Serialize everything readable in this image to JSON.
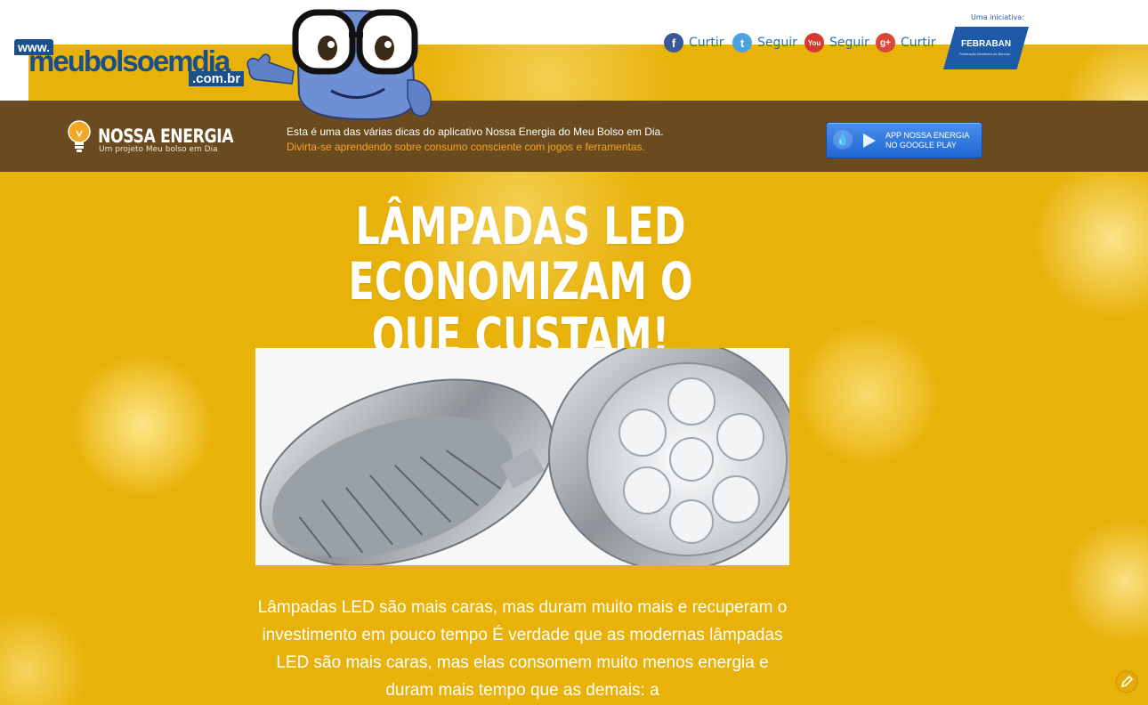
{
  "header": {
    "logo": {
      "www": "www.",
      "main": "meubolsoemdia",
      "domain": ".com.br"
    },
    "social": [
      {
        "label": "Curtir",
        "icon": "facebook-icon",
        "glyph": "f"
      },
      {
        "label": "Seguir",
        "icon": "twitter-icon",
        "glyph": "t"
      },
      {
        "label": "Seguir",
        "icon": "youtube-icon",
        "glyph": "You"
      },
      {
        "label": "Curtir",
        "icon": "google-plus-icon",
        "glyph": "g+"
      }
    ],
    "initiative_label": "Uma iniciativa:",
    "febraban": {
      "name": "FEBRABAN",
      "sub": "Federação Brasileira de Bancos"
    }
  },
  "banner": {
    "brand": "NOSSA ENERGIA",
    "brand_sub": "Um projeto Meu bolso em Dia",
    "tip_line1": "Esta é uma das várias dicas do aplicativo Nossa Energia do Meu Bolso em Dia.",
    "tip_line2": "Divirta-se aprendendo sobre consumo consciente com jogos e ferramentas.",
    "play_button": {
      "line1": "APP NOSSA ENERGIA",
      "line2": "NO GOOGLE PLAY"
    }
  },
  "article": {
    "headline": "LÂMPADAS LED ECONOMIZAM O QUE CUSTAM!",
    "body": "Lâmpadas LED são mais caras, mas duram muito mais e recuperam o investimento em pouco tempo É verdade que as modernas lâmpadas LED são mais caras, mas elas consomem muito menos energia e duram mais tempo que as demais: a"
  },
  "colors": {
    "brand_blue": "#1b4f8a",
    "banner_brown": "#6a4b1f",
    "background_yellow": "#e8b20a",
    "tip_orange": "#f5a623",
    "play_blue": "#1f66d1"
  }
}
